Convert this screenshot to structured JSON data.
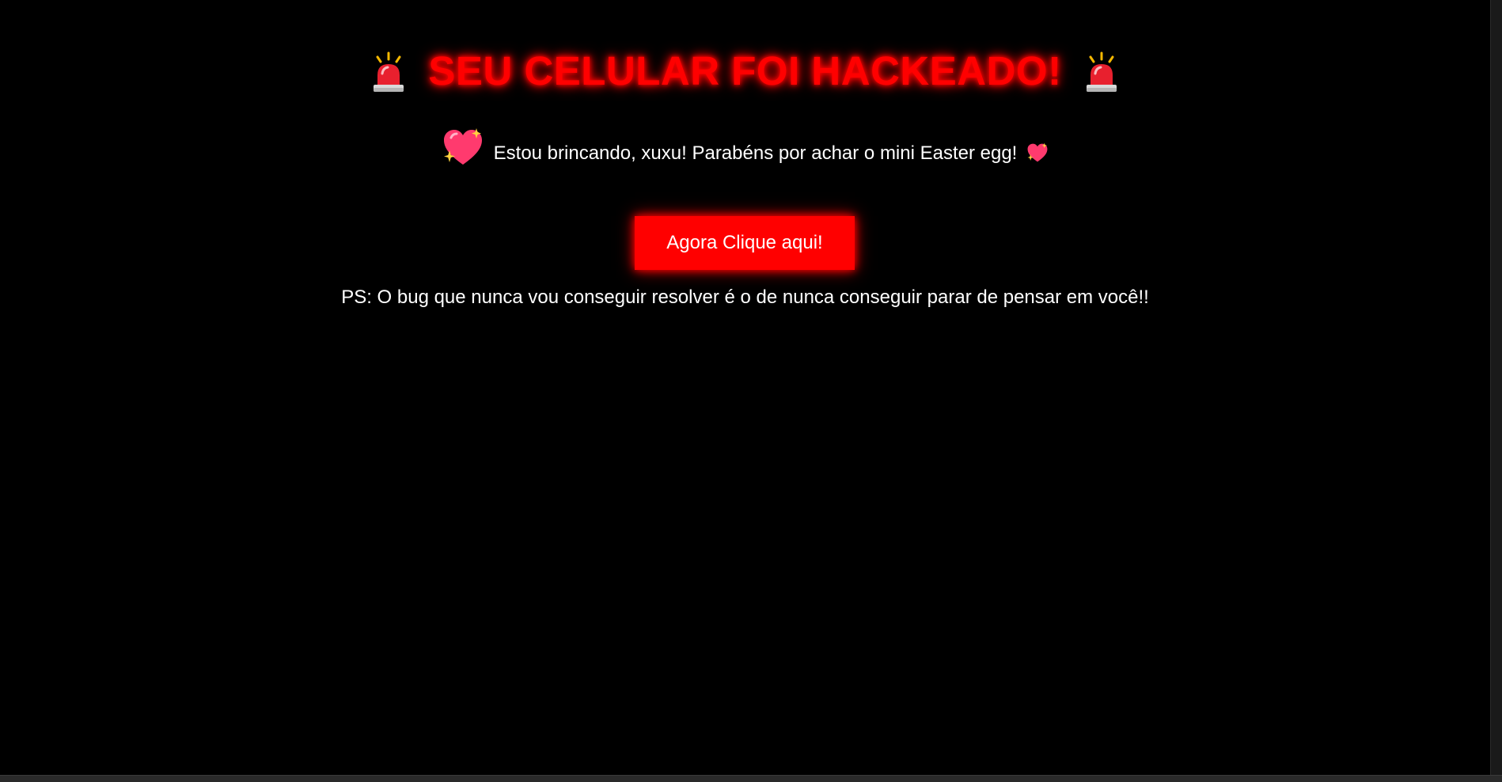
{
  "headline": {
    "text": "SEU CELULAR FOI HACKEADO!",
    "left_icon": "siren-icon",
    "right_icon": "siren-icon",
    "color": "#ff0000"
  },
  "message": {
    "text": "Estou brincando, xuxu! Parabéns por achar o mini Easter egg!",
    "leading_icon": "sparkling-heart-icon",
    "trailing_icon": "sparkling-heart-icon"
  },
  "cta": {
    "label": "Agora Clique aqui!",
    "color": "#ff0000"
  },
  "ps": {
    "text": "PS: O bug que nunca vou conseguir resolver é o de nunca conseguir parar de pensar em você!!"
  },
  "colors": {
    "background": "#000000",
    "text": "#ffffff",
    "accent": "#ff0000"
  }
}
